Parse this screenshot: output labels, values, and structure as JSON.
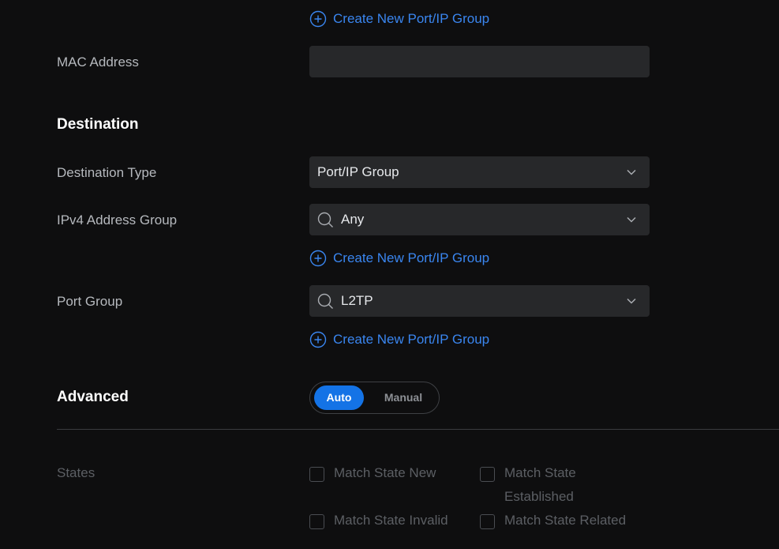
{
  "source": {
    "create_group_link": "Create New Port/IP Group",
    "mac_address_label": "MAC Address",
    "mac_address_value": ""
  },
  "destination": {
    "heading": "Destination",
    "type_label": "Destination Type",
    "type_value": "Port/IP Group",
    "ipv4_label": "IPv4 Address Group",
    "ipv4_value": "Any",
    "ipv4_create_link": "Create New Port/IP Group",
    "port_label": "Port Group",
    "port_value": "L2TP",
    "port_create_link": "Create New Port/IP Group"
  },
  "advanced": {
    "heading": "Advanced",
    "mode_auto": "Auto",
    "mode_manual": "Manual",
    "selected_mode": "Auto"
  },
  "states": {
    "label": "States",
    "options": [
      {
        "label_line1": "Match State New",
        "label_line2": "",
        "checked": false
      },
      {
        "label_line1": "Match State",
        "label_line2": "Established",
        "checked": false
      },
      {
        "label_line1": "Match State Invalid",
        "label_line2": "",
        "checked": false
      },
      {
        "label_line1": "Match State Related",
        "label_line2": "",
        "checked": false
      }
    ]
  },
  "colors": {
    "background": "#0e0e0f",
    "field": "#27282a",
    "accent": "#1473e6",
    "link": "#3a86f0"
  }
}
